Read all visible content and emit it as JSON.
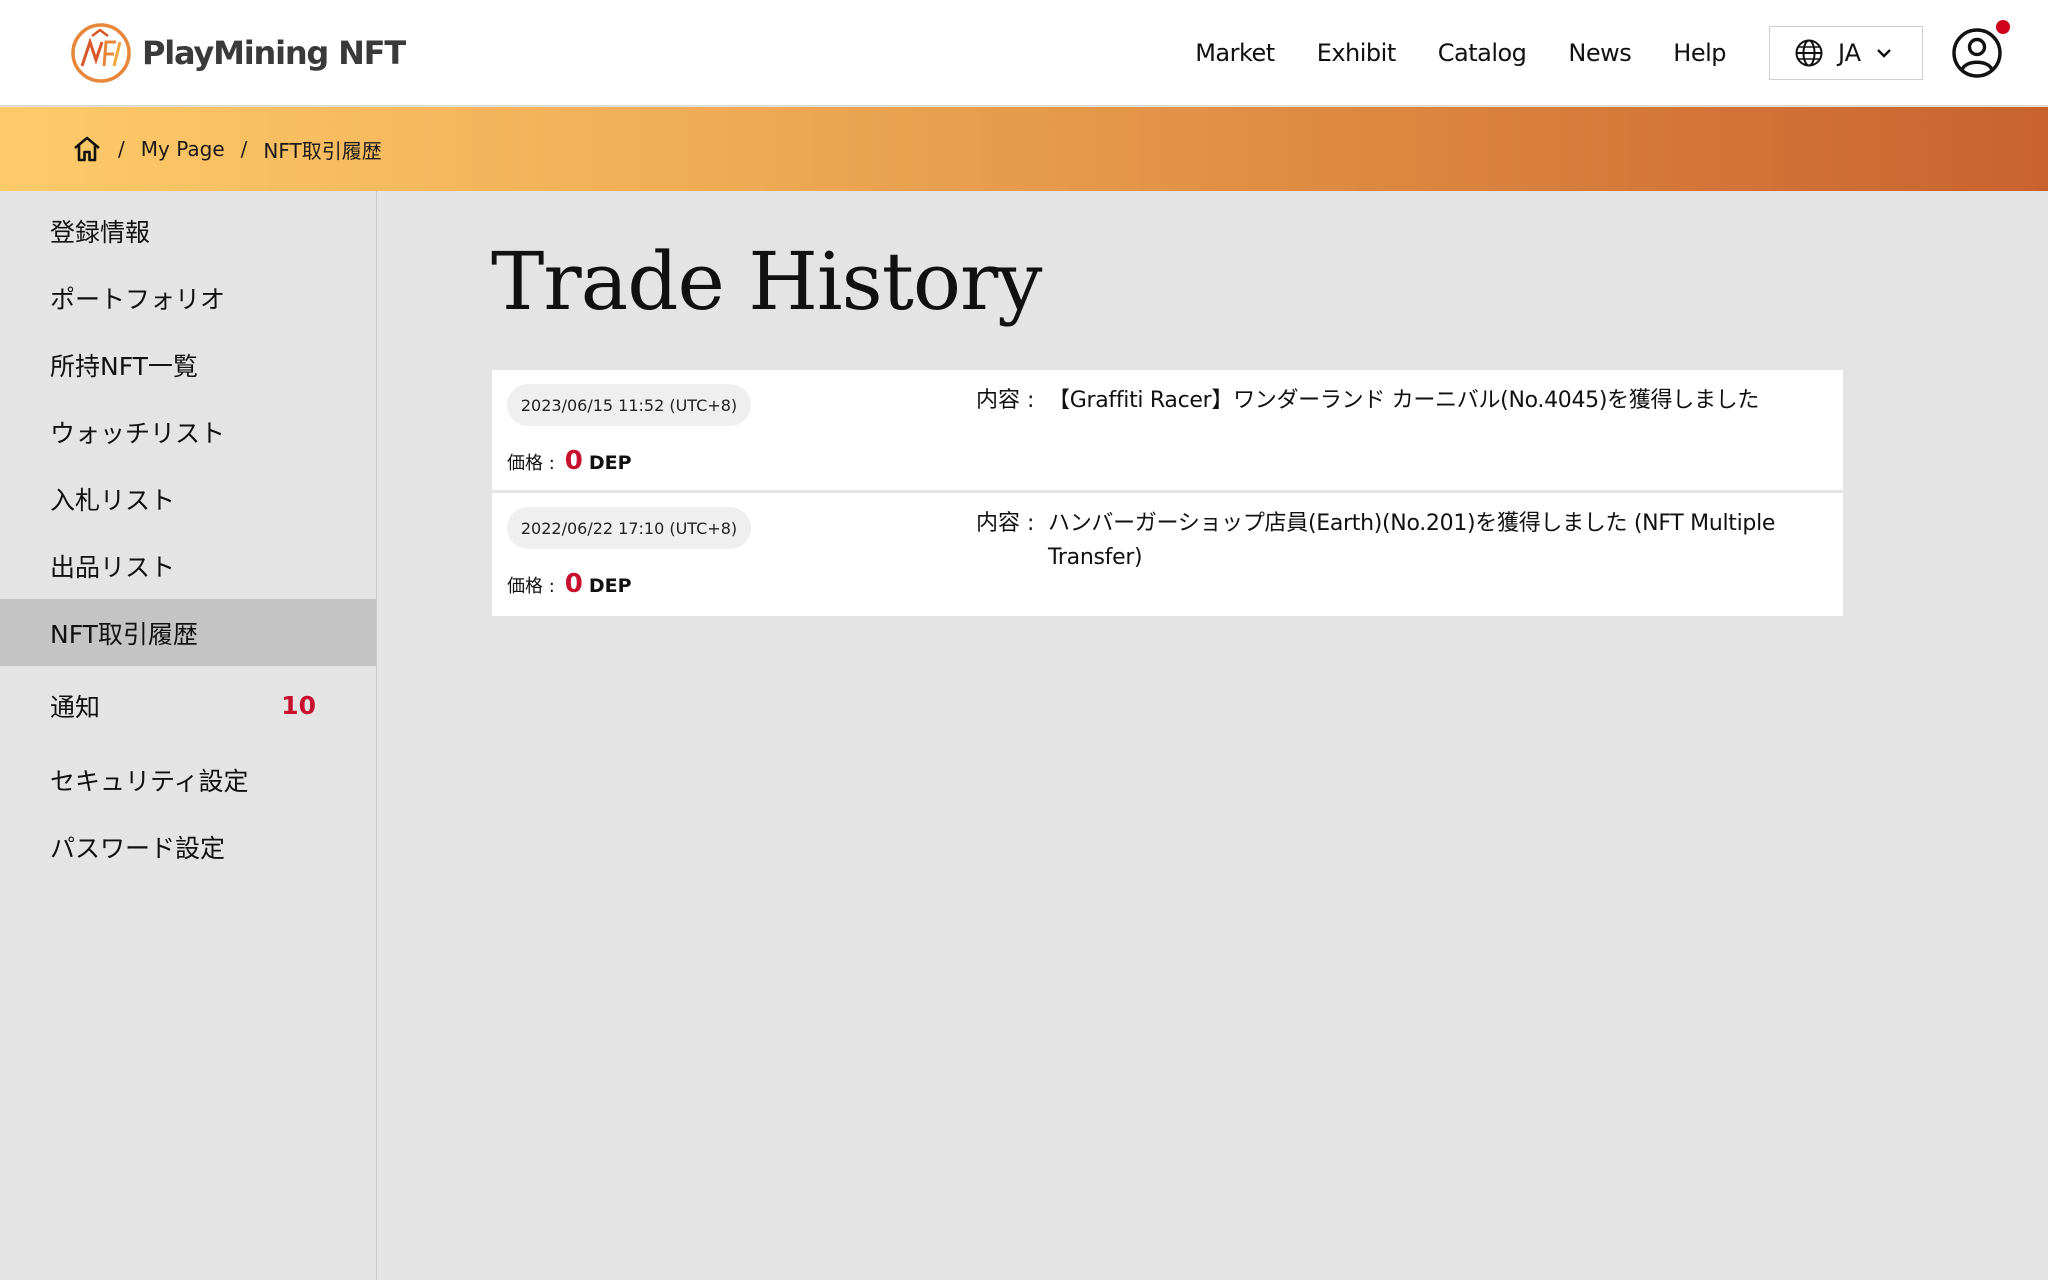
{
  "header": {
    "logo_text": "PlayMining NFT",
    "nav": [
      "Market",
      "Exhibit",
      "Catalog",
      "News",
      "Help"
    ],
    "language": "JA",
    "brand_color": "#e0683a"
  },
  "breadcrumb": {
    "home_icon": "home-icon",
    "items": [
      "My Page",
      "NFT取引履歴"
    ],
    "separator": "/"
  },
  "sidebar": {
    "items": [
      {
        "label": "登録情報"
      },
      {
        "label": "ポートフォリオ"
      },
      {
        "label": "所持NFT一覧"
      },
      {
        "label": "ウォッチリスト"
      },
      {
        "label": "入札リスト"
      },
      {
        "label": "出品リスト"
      },
      {
        "label": "NFT取引履歴",
        "active": true
      },
      {
        "label": "通知",
        "count": "10"
      },
      {
        "label": "セキュリティ設定"
      },
      {
        "label": "パスワード設定"
      }
    ]
  },
  "main": {
    "title": "Trade History",
    "price_label": "価格 :",
    "content_label": "内容 :",
    "trades": [
      {
        "date": "2023/06/15 11:52 (UTC+8)",
        "price": "0",
        "unit": "DEP",
        "content": "【Graffiti Racer】ワンダーランド カーニバル(No.4045)を獲得しました"
      },
      {
        "date": "2022/06/22 17:10 (UTC+8)",
        "price": "0",
        "unit": "DEP",
        "content": "ハンバーガーショップ店員(Earth)(No.201)を獲得しました (NFT Multiple Transfer)"
      }
    ]
  },
  "colors": {
    "accent_red": "#c8102e",
    "gradient_start": "#fecb6a",
    "gradient_end": "#c9622f"
  }
}
